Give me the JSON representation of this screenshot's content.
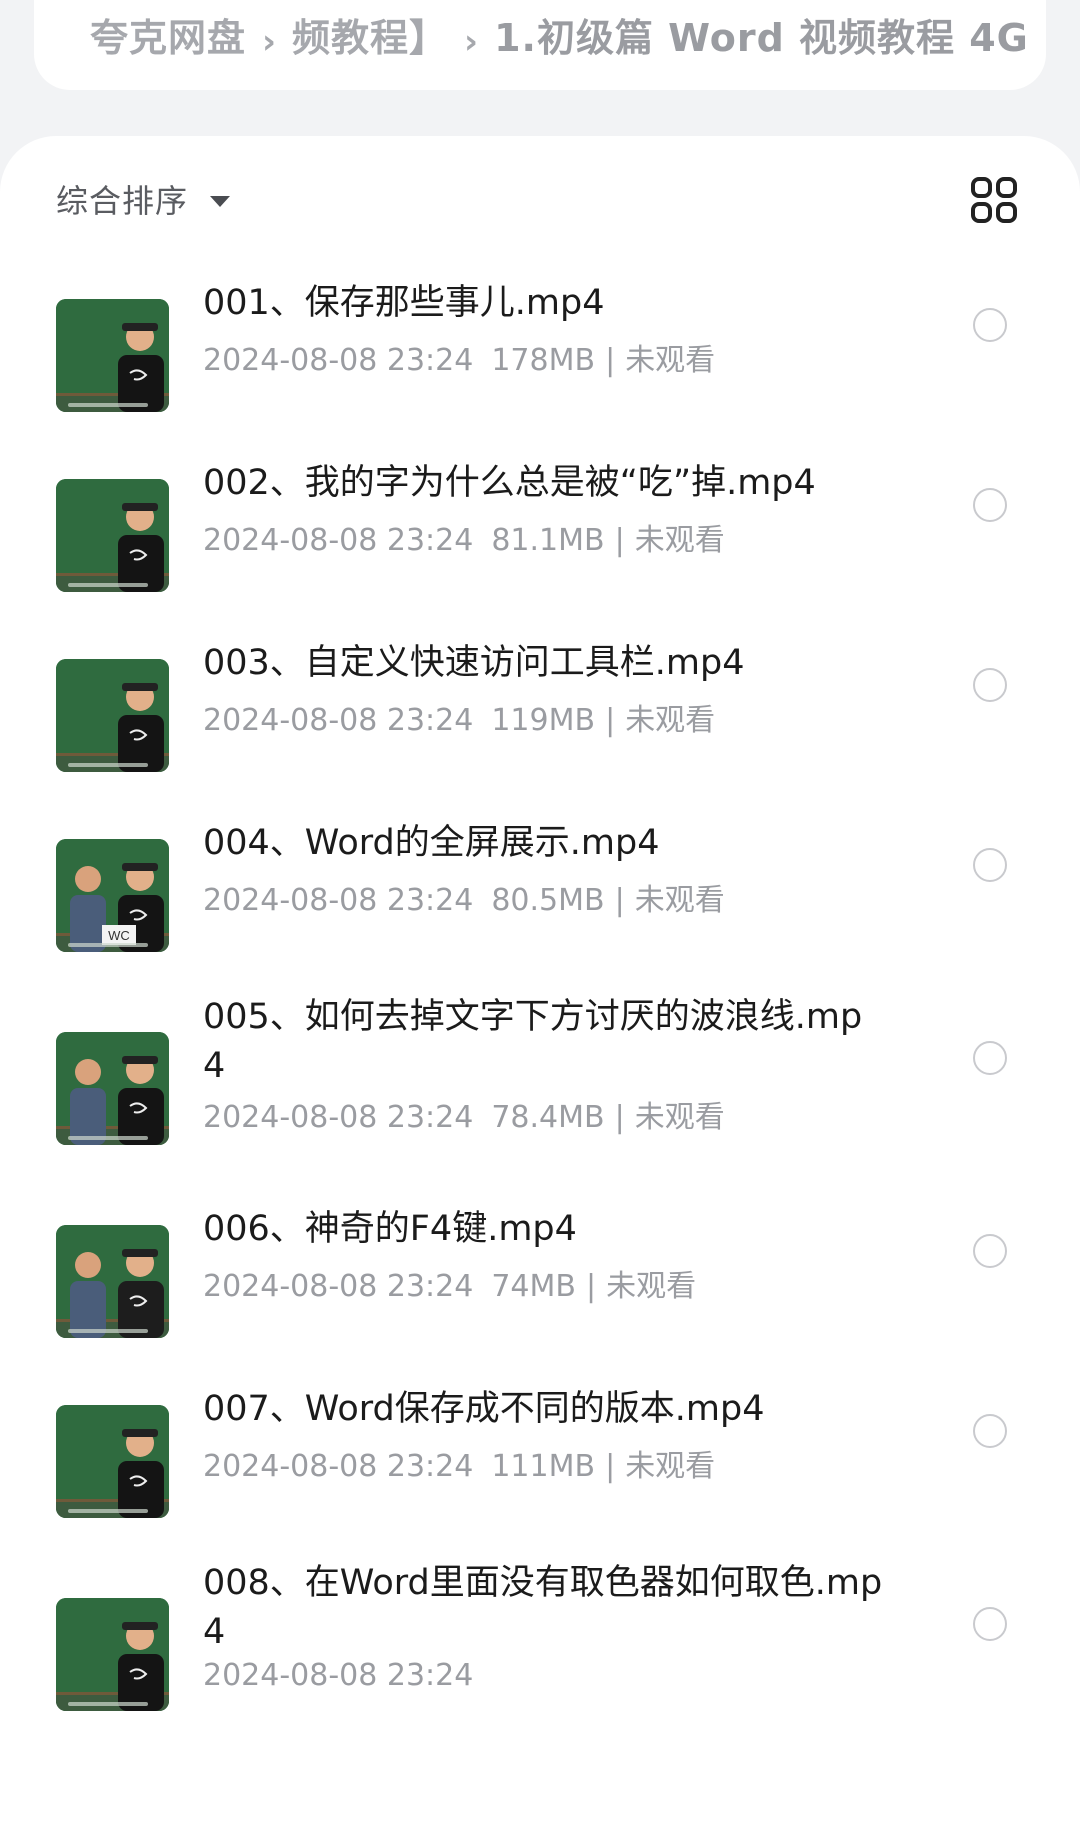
{
  "breadcrumb": {
    "root": "夸克网盘",
    "parent": "频教程】",
    "current": "1.初级篇 Word 视频教程 4G",
    "separator": "›"
  },
  "toolbar": {
    "sort_label": "综合排序",
    "caret_icon": "caret-down-icon",
    "view_toggle_icon": "grid-view-icon"
  },
  "files": [
    {
      "title": "001、保存那些事儿.mp4",
      "date": "2024-08-08 23:24",
      "size": "178MB",
      "status": "未观看",
      "thumb_caption": ""
    },
    {
      "title": "002、我的字为什么总是被“吃”掉.mp4",
      "date": "2024-08-08 23:24",
      "size": "81.1MB",
      "status": "未观看",
      "thumb_caption": ""
    },
    {
      "title": "003、自定义快速访问工具栏.mp4",
      "date": "2024-08-08 23:24",
      "size": "119MB",
      "status": "未观看",
      "thumb_caption": ""
    },
    {
      "title": "004、Word的全屏展示.mp4",
      "date": "2024-08-08 23:24",
      "size": "80.5MB",
      "status": "未观看",
      "thumb_caption": "WC"
    },
    {
      "title": "005、如何去掉文字下方讨厌的波浪线.mp4",
      "date": "2024-08-08 23:24",
      "size": "78.4MB",
      "status": "未观看",
      "thumb_caption": ""
    },
    {
      "title": "006、神奇的F4键.mp4",
      "date": "2024-08-08 23:24",
      "size": "74MB",
      "status": "未观看",
      "thumb_caption": ""
    },
    {
      "title": "007、Word保存成不同的版本.mp4",
      "date": "2024-08-08 23:24",
      "size": "111MB",
      "status": "未观看",
      "thumb_caption": ""
    },
    {
      "title": "008、在Word里面没有取色器如何取色.mp4",
      "date": "2024-08-08 23:24",
      "size": "",
      "status": "",
      "thumb_caption": ""
    }
  ],
  "meta_separator": "|",
  "colors": {
    "background": "#f2f3f5",
    "panel": "#ffffff",
    "title_text": "#1b1b1b",
    "meta_text": "#9a9ca1",
    "chalkboard": "#2f6b3f",
    "radio_border": "#c9cace"
  }
}
